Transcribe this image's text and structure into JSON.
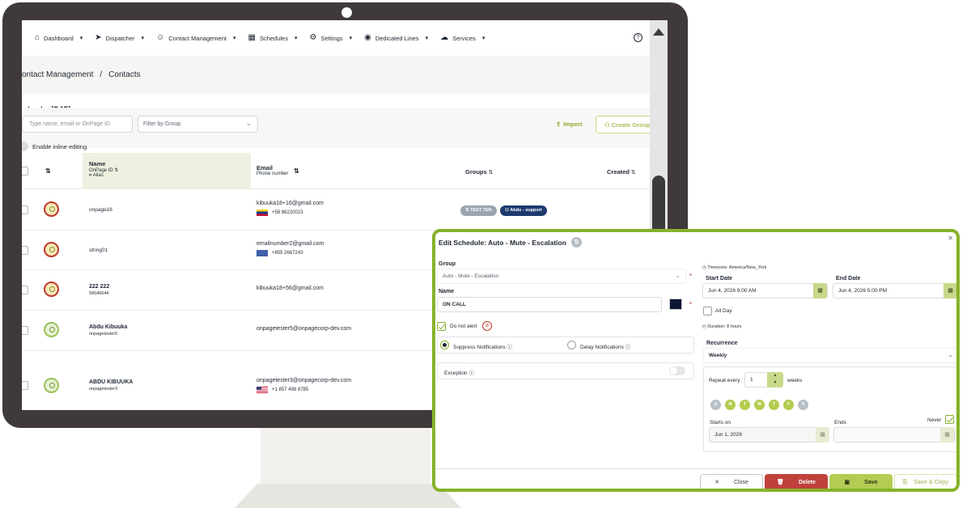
{
  "nav": {
    "items": [
      {
        "label": "Dashboard",
        "icon": "home-icon"
      },
      {
        "label": "Dispatcher",
        "icon": "send-icon"
      },
      {
        "label": "Contact Management",
        "icon": "user-icon"
      },
      {
        "label": "Schedules",
        "icon": "calendar-icon"
      },
      {
        "label": "Settings",
        "icon": "gear-icon"
      },
      {
        "label": "Dedicated Lines",
        "icon": "headset-icon"
      },
      {
        "label": "Services",
        "icon": "cloud-icon"
      }
    ],
    "help_icon": "?"
  },
  "breadcrumb": {
    "part1": "ontact Management",
    "sep": "/",
    "part2": "Contacts"
  },
  "page_title": "ntacts (245)",
  "filters": {
    "search_placeholder": "Type name, email or OnPage ID",
    "group_select": "Filter by Group",
    "import_label": "Import",
    "create_group_label": "Create Group",
    "inline_editing_label": "Enable inline editing"
  },
  "table": {
    "headers": {
      "name": "Name",
      "onpage_id": "OnPage ID",
      "alias": "Alias",
      "email": "Email",
      "phone_number": "Phone number",
      "groups": "Groups",
      "created": "Created"
    },
    "rows": [
      {
        "name": "",
        "id": "onpage16",
        "email": "kibuuka18+16@gmail.com",
        "phone": "+58 86220023",
        "flag": "ve",
        "groups": [
          "TEST TEN",
          "Abdu - support"
        ],
        "avatar_state": "red"
      },
      {
        "name": "",
        "id": "string01",
        "email": "emailnumber2@gmail.com",
        "phone": "+855 2667243",
        "flag": "kh",
        "groups": [],
        "avatar_state": "red"
      },
      {
        "name": "222 222",
        "id": "58646644",
        "email": "kibuuka18+56@gmail.com",
        "phone": "",
        "flag": "",
        "groups": [],
        "avatar_state": "red"
      },
      {
        "name": "Abdu Kibuuka",
        "id": "onpagetester5",
        "email": "onpagetester5@onpagecorp-dev.com",
        "phone": "",
        "flag": "",
        "groups": [],
        "avatar_state": "green"
      },
      {
        "name": "ABDU KIBUUKA",
        "id": "onpagetester3",
        "email": "onpagetester3@onpagecorp-dev.com",
        "phone": "+1 857 498 8785",
        "flag": "us",
        "groups": [],
        "avatar_state": "green"
      }
    ]
  },
  "modal": {
    "title": "Edit Schedule: Auto - Mute - Escalation",
    "title_badge": "⇅",
    "group_label": "Group",
    "group_value": "Auto - Mute - Escalation",
    "name_label": "Name",
    "name_value": "ON CALL",
    "required_mark": "*",
    "do_not_alert_label": "Do not alert",
    "suppress_label": "Suppress Notifications",
    "delay_label": "Delay Notifications",
    "exception_label": "Exception",
    "timezone": "Timezone: America/New_York",
    "start_date_label": "Start Date",
    "start_date_value": "Jun 4, 2026 9:00 AM",
    "end_date_label": "End Date",
    "end_date_value": "Jun 4, 2026 5:00 PM",
    "all_day_label": "All Day",
    "duration": "Duration: 8 hours",
    "recurrence_label": "Recurrence",
    "recurrence_value": "Weekly",
    "repeat_every_label": "Repeat every",
    "repeat_every_value": "1",
    "repeat_unit": "weeks",
    "days": [
      {
        "label": "S",
        "on": false
      },
      {
        "label": "M",
        "on": true
      },
      {
        "label": "T",
        "on": true
      },
      {
        "label": "W",
        "on": true
      },
      {
        "label": "T",
        "on": true
      },
      {
        "label": "F",
        "on": true
      },
      {
        "label": "S",
        "on": false
      }
    ],
    "starts_on_label": "Starts on",
    "starts_on_value": "Jun 1, 2026",
    "ends_label": "Ends",
    "never_label": "Never",
    "buttons": {
      "close": "Close",
      "delete": "Delete",
      "save": "Save",
      "save_copy": "Save & Copy"
    }
  },
  "colors": {
    "accent": "#86b22a",
    "monitor_frame": "#3f3939",
    "delete": "#c0413c",
    "schedule_color": "#0a1633"
  }
}
